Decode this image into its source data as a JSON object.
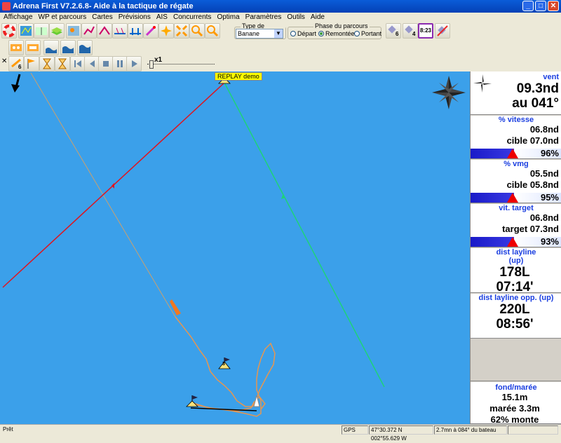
{
  "window": {
    "title": "Adrena First V7.2.6.8- Aide à la tactique de régate"
  },
  "menu": [
    "Affichage",
    "WP et parcours",
    "Cartes",
    "Prévisions",
    "AIS",
    "Concurrents",
    "Optima",
    "Paramètres",
    "Outils",
    "Aide"
  ],
  "parcours": {
    "type_label": "Type de parcours",
    "type_value": "Banane",
    "phase_label": "Phase du parcours",
    "phases": [
      {
        "label": "Départ",
        "selected": false
      },
      {
        "label": "Remontée",
        "selected": true
      },
      {
        "label": "Portant",
        "selected": false
      }
    ]
  },
  "toolbar": {
    "badge_6": "6",
    "badge_4": "4",
    "clock": "8:23",
    "speed_label": "x1",
    "badge_6b": "6"
  },
  "map": {
    "replay_label": "REPLAY demo",
    "mark_1": "1",
    "mark_3": "3",
    "colors": {
      "water": "#3ba0ea",
      "red_line": "#e0141e",
      "green_line": "#1ed27a",
      "track": "#e69650"
    }
  },
  "panels": {
    "vent": {
      "title": "vent",
      "line1": "09.3nd",
      "line2": "au 041°"
    },
    "vitesse": {
      "title": "% vitesse",
      "line1": "06.8nd",
      "line2": "cible 07.0nd",
      "pct": "96%",
      "pct_value": 96
    },
    "vmg": {
      "title": "% vmg",
      "line1": "05.5nd",
      "line2": "cible 05.8nd",
      "pct": "95%",
      "pct_value": 95
    },
    "target": {
      "title": "vit. target",
      "line1": "06.8nd",
      "line2": "target 07.3nd",
      "pct": "93%",
      "pct_value": 93
    },
    "layline": {
      "title": "dist layline (up)",
      "line1": "178L",
      "line2": "07:14'"
    },
    "layline_opp": {
      "title": "dist layline opp. (up)",
      "line1": "220L",
      "line2": "08:56'"
    },
    "fond": {
      "title": "fond/marée",
      "line1": "15.1m",
      "line2": "marée 3.3m",
      "line3": "62% monte"
    }
  },
  "status": {
    "left": "Prêt",
    "gps": "GPS",
    "coords": "47°30.372 N 002°55.629 W",
    "info": "2.7mn à 084° du bateau"
  }
}
